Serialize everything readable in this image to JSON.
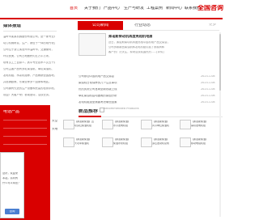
{
  "nav": {
    "items": [
      "首页",
      "关于我们",
      "产品中心",
      "生产与研发",
      "工程案例",
      "新闻中心",
      "联系我们"
    ],
    "brand": "全国咨询"
  },
  "left": {
    "title": "媒体报道",
    "lines": [
      "温岭市某某机械股份有限公司，是一家专业从事",
      "动力机械研发、生产、销售于一体的现代化企业。",
      "公司位于浙江省台州市温岭市，交通便利，",
      "环境优美，公司占地面积约五万平方米，",
      "现有员工三百余人，其中专业技术人员五十余名。",
      "公司主要产品有多缸柴油机、单缸柴油机、",
      "发电机组、水泵机组等，产品畅销全国各地，",
      "并远销欧美、东南亚等多个国家和地区。",
      "公司拥有先进的生产设备和完善的检测手段，",
      "欢迎广大客户来厂参观指导，洽谈业务。"
    ],
    "red_title": "电话产品",
    "popup": {
      "lines": [
        "您好，欢迎来",
        "本站。请问有",
        "什么可以帮您？"
      ],
      "button": "咨询"
    }
  },
  "tabs": {
    "company": "公司新闻",
    "industry": "行业动态",
    "more": "更多"
  },
  "feature": {
    "title": "弗诺斯柴动机再度亮相机电展",
    "desc": [
      "近日，弗诺斯柴动机再度亮相中国机电产品交易会，",
      "公司多款新品柴油机和发电机组引起了参展商和",
      "客户的广泛关注，现场洽谈氛围热烈……[详情]"
    ]
  },
  "news": [
    {
      "title": "公司参加中国机电产品交易会",
      "date": "2023-1-08"
    },
    {
      "title": "柴油机日常保养的几个注意事项",
      "date": "2023-1-08"
    },
    {
      "title": "热烈庆祝公司官网全新改版上线",
      "date": "2023-1-08"
    },
    {
      "title": "单缸柴油机启动困难的原因分析",
      "date": "2023-1-08"
    },
    {
      "title": "发电机组选型需要考虑哪些因素",
      "date": "2023-1-08"
    }
  ],
  "new_products": {
    "title": "新品推荐",
    "rec_label": "Recommended Products",
    "left_links": [
      "天空",
      "天地"
    ],
    "items": [
      {
        "l1": "【弗诺斯柴油】直",
        "l2": "喷多缸柴油机组"
      },
      {
        "l1": "【弗诺斯柴油】",
        "l2": "水冷发电机组"
      },
      {
        "l1": "【弗诺斯柴油】",
        "l2": "风冷单缸柴油机"
      },
      {
        "l1": "【弗诺斯柴油】",
        "l2": "静音发电机组"
      },
      {
        "l1": "【弗诺斯柴油】",
        "l2": "大功率柴油机"
      },
      {
        "l1": "【弗诺斯柴油】",
        "l2": "柴油水泵机组"
      },
      {
        "l1": "【弗诺斯柴油】",
        "l2": "多缸发动机总成"
      },
      {
        "l1": "【弗诺斯柴油】",
        "l2": "移动电站机组"
      }
    ]
  }
}
